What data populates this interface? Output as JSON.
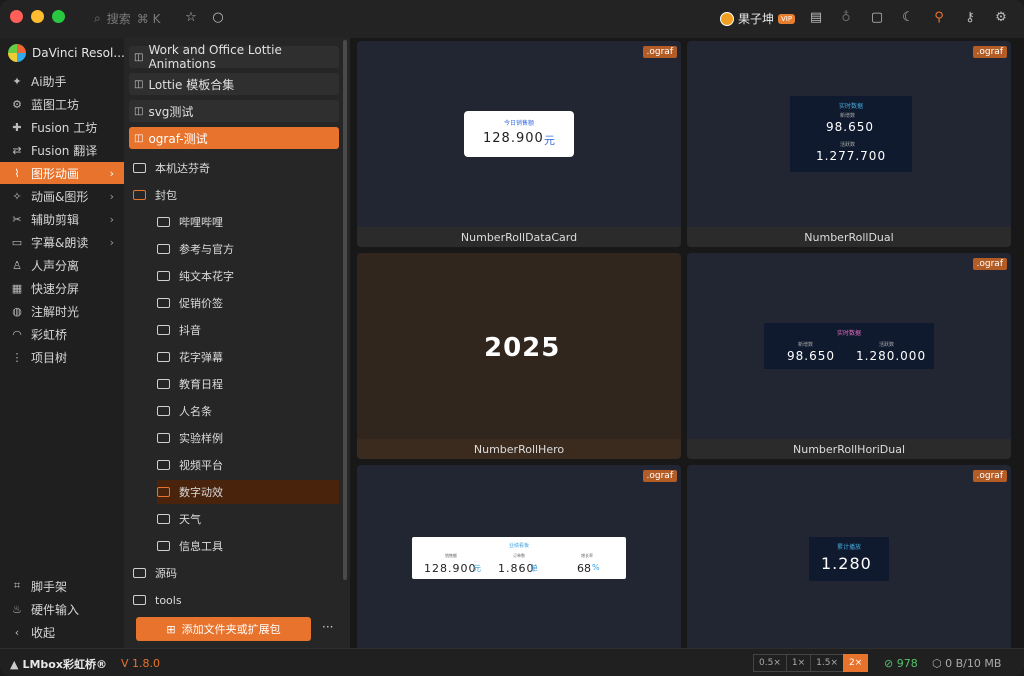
{
  "toolbar": {
    "search_placeholder": "搜索",
    "search_shortcut": "⌘ K",
    "user_name": "果子坤",
    "user_badge": "VIP"
  },
  "app": {
    "name": "DaVinci Resol..."
  },
  "nav": {
    "items": [
      {
        "label": "Ai助手",
        "icon": "✦",
        "chev": false
      },
      {
        "label": "蓝图工坊",
        "icon": "⚙",
        "chev": false
      },
      {
        "label": "Fusion 工坊",
        "icon": "✚",
        "chev": false
      },
      {
        "label": "Fusion 翻译",
        "icon": "⇄",
        "chev": false
      },
      {
        "label": "图形动画",
        "icon": "⌇",
        "chev": true,
        "active": true
      },
      {
        "label": "动画&图形",
        "icon": "✧",
        "chev": true
      },
      {
        "label": "辅助剪辑",
        "icon": "✂",
        "chev": true
      },
      {
        "label": "字幕&朗读",
        "icon": "▭",
        "chev": true
      },
      {
        "label": "人声分离",
        "icon": "♙",
        "chev": false
      },
      {
        "label": "快速分屏",
        "icon": "▦",
        "chev": false
      },
      {
        "label": "注解时光",
        "icon": "◍",
        "chev": false
      },
      {
        "label": "彩虹桥",
        "icon": "◠",
        "chev": false
      },
      {
        "label": "项目树",
        "icon": "⋮",
        "chev": false
      }
    ],
    "bottom": [
      {
        "label": "脚手架",
        "icon": "⌗"
      },
      {
        "label": "硬件输入",
        "icon": "♨"
      },
      {
        "label": "收起",
        "icon": "‹"
      }
    ]
  },
  "folders": {
    "pills": [
      {
        "label": "Work and Office Lottie Animations"
      },
      {
        "label": "Lottie 模板合集"
      },
      {
        "label": "svg测试"
      },
      {
        "label": "ograf-测试",
        "active": true
      }
    ],
    "tree": [
      {
        "label": "本机达芬奇",
        "level": 0
      },
      {
        "label": "封包",
        "level": 0,
        "open": true
      },
      {
        "label": "哔哩哔哩",
        "level": 1
      },
      {
        "label": "参考与官方",
        "level": 1
      },
      {
        "label": "纯文本花字",
        "level": 1
      },
      {
        "label": "促销价签",
        "level": 1
      },
      {
        "label": "抖音",
        "level": 1
      },
      {
        "label": "花字弹幕",
        "level": 1
      },
      {
        "label": "教育日程",
        "level": 1
      },
      {
        "label": "人名条",
        "level": 1
      },
      {
        "label": "实验样例",
        "level": 1
      },
      {
        "label": "视频平台",
        "level": 1
      },
      {
        "label": "数字动效",
        "level": 1,
        "open": true,
        "selected": true
      },
      {
        "label": "天气",
        "level": 1
      },
      {
        "label": "信息工具",
        "level": 1
      },
      {
        "label": "源码",
        "level": 0
      },
      {
        "label": "tools",
        "level": 0
      }
    ],
    "add_button": "添加文件夹或扩展包",
    "more": "···"
  },
  "cards": [
    {
      "name": "NumberRollDataCard",
      "tag": ".ograf",
      "style": "dark",
      "preview": {
        "kind": "datacard",
        "title": "今日销售额",
        "value": "128.900",
        "unit": "元"
      }
    },
    {
      "name": "NumberRollDual",
      "tag": ".ograf",
      "style": "dark",
      "preview": {
        "kind": "dual",
        "title": "实时数据",
        "label1": "新增数",
        "value1": "98.650",
        "label2": "活跃数",
        "value2": "1.277.700"
      }
    },
    {
      "name": "NumberRollHero",
      "tag": "",
      "style": "brown",
      "preview": {
        "kind": "hero",
        "value": "2025"
      }
    },
    {
      "name": "NumberRollHoriDual",
      "tag": ".ograf",
      "style": "dark",
      "preview": {
        "kind": "horidual",
        "title": "实时数据",
        "label1": "新增数",
        "value1": "98.650",
        "label2": "活跃数",
        "value2": "1.280.000"
      }
    },
    {
      "name": "",
      "tag": ".ograf",
      "style": "dark",
      "preview": {
        "kind": "triple",
        "title": "业绩看板",
        "l1": "销售额",
        "v1": "128.900",
        "u1": "元",
        "l2": "订单数",
        "v2": "1.860",
        "u2": "单",
        "l3": "增长率",
        "v3": "68",
        "u3": "%"
      }
    },
    {
      "name": "",
      "tag": ".ograf",
      "style": "dark",
      "preview": {
        "kind": "counter",
        "title": "累计播放",
        "value": "1.280"
      }
    }
  ],
  "status": {
    "brand": "LMbox彩虹桥®",
    "version": "V 1.8.0",
    "zooms": [
      "0.5×",
      "1×",
      "1.5×",
      "2×"
    ],
    "zoom_active": "2×",
    "count": "978",
    "memory": "0 B/10 MB"
  },
  "colors": {
    "accent": "#e8732c",
    "tag": "#b35c26",
    "count": "#56c06a"
  }
}
